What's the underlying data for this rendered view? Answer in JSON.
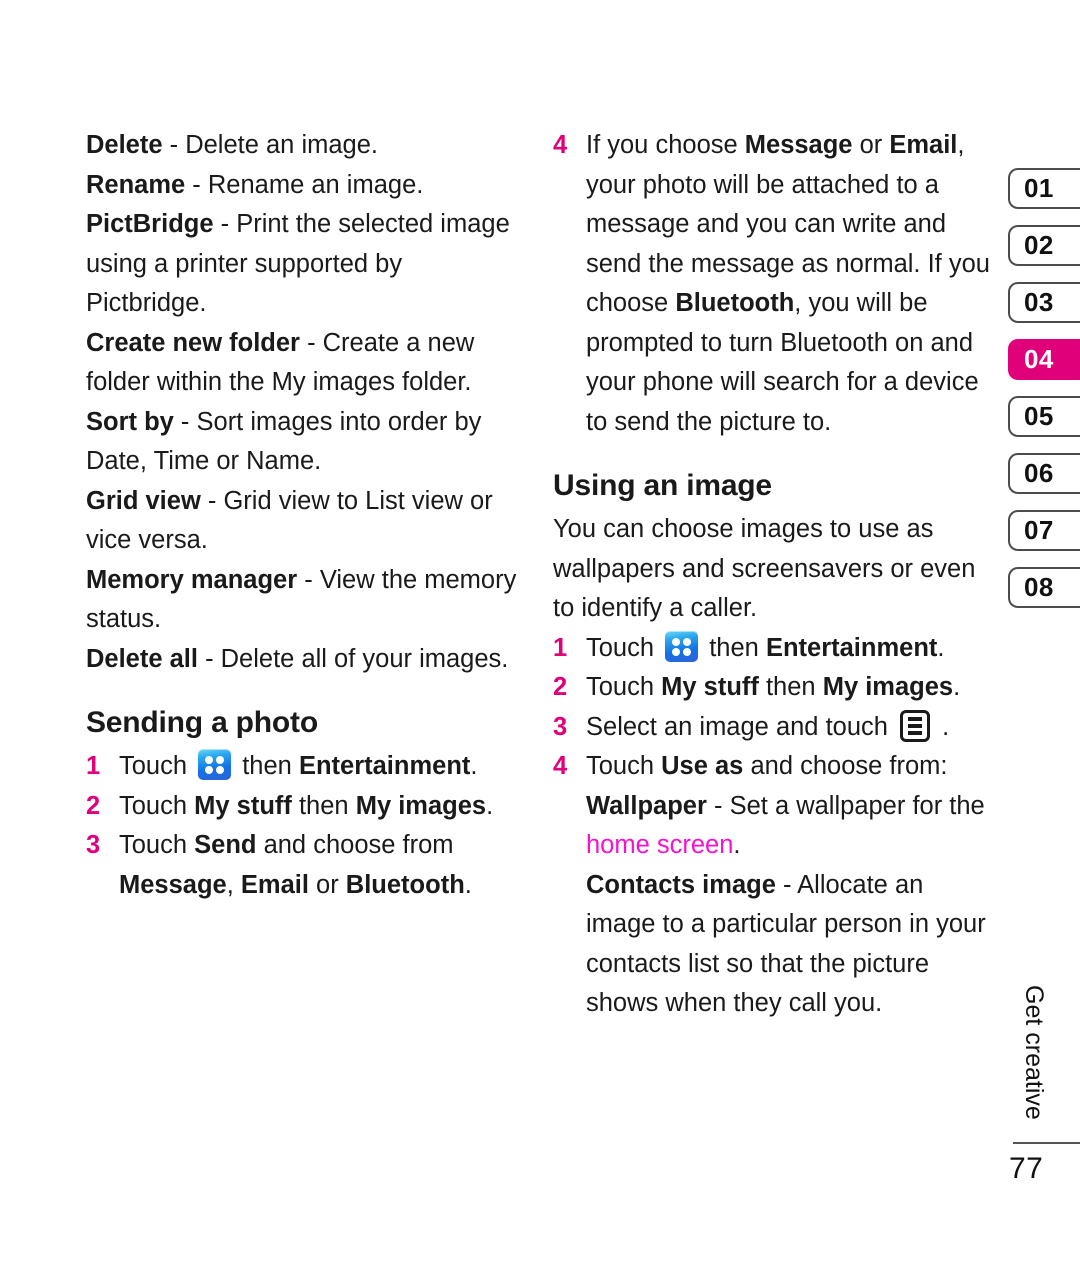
{
  "page": {
    "folio": "77",
    "chapter_label": "Get creative",
    "accent_color": "#e0007a",
    "link_color": "#f712d0"
  },
  "tabs": {
    "items": [
      {
        "label": "01",
        "active": false
      },
      {
        "label": "02",
        "active": false
      },
      {
        "label": "03",
        "active": false
      },
      {
        "label": "04",
        "active": true
      },
      {
        "label": "05",
        "active": false
      },
      {
        "label": "06",
        "active": false
      },
      {
        "label": "07",
        "active": false
      },
      {
        "label": "08",
        "active": false
      }
    ]
  },
  "left_column": {
    "definitions": [
      {
        "term": "Delete",
        "dash": " - ",
        "desc": "Delete an image."
      },
      {
        "term": "Rename",
        "dash": " - ",
        "desc": "Rename an image."
      },
      {
        "term": "PictBridge",
        "dash": " - ",
        "desc": "Print the selected image using a printer supported by Pictbridge."
      },
      {
        "term": "Create new folder",
        "dash": " - ",
        "desc": "Create a new folder within the My images folder."
      },
      {
        "term": "Sort by",
        "dash": " - ",
        "desc": "Sort images into order by Date, Time or Name."
      },
      {
        "term": "Grid view",
        "dash": " - ",
        "desc": "Grid view to List view or vice versa."
      },
      {
        "term": "Memory manager",
        "dash": " - ",
        "desc": "View the memory status."
      },
      {
        "term": "Delete all",
        "dash": " - ",
        "desc": "Delete all of your images."
      }
    ],
    "section": {
      "heading": "Sending a photo",
      "steps": [
        {
          "num": "1",
          "parts": [
            {
              "t": "Touch ",
              "style": "normal"
            },
            {
              "t": "grid-icon",
              "style": "icon-grid"
            },
            {
              "t": " then ",
              "style": "normal"
            },
            {
              "t": "Entertainment",
              "style": "bold"
            },
            {
              "t": ".",
              "style": "normal"
            }
          ]
        },
        {
          "num": "2",
          "parts": [
            {
              "t": "Touch ",
              "style": "normal"
            },
            {
              "t": "My stuff",
              "style": "bold"
            },
            {
              "t": " then ",
              "style": "normal"
            },
            {
              "t": "My images",
              "style": "bold"
            },
            {
              "t": ".",
              "style": "normal"
            }
          ]
        },
        {
          "num": "3",
          "parts": [
            {
              "t": "Touch ",
              "style": "normal"
            },
            {
              "t": "Send",
              "style": "bold"
            },
            {
              "t": " and choose from ",
              "style": "normal"
            },
            {
              "t": "Message",
              "style": "bold"
            },
            {
              "t": ", ",
              "style": "normal"
            },
            {
              "t": "Email",
              "style": "bold"
            },
            {
              "t": " or ",
              "style": "normal"
            },
            {
              "t": "Bluetooth",
              "style": "bold"
            },
            {
              "t": ".",
              "style": "normal"
            }
          ]
        }
      ]
    }
  },
  "right_column": {
    "continued_step": {
      "num": "4",
      "parts": [
        {
          "t": "If you choose ",
          "style": "normal"
        },
        {
          "t": "Message",
          "style": "bold"
        },
        {
          "t": " or ",
          "style": "normal"
        },
        {
          "t": "Email",
          "style": "bold"
        },
        {
          "t": ", your photo will be attached to a message and you can write and send the message as normal. If you choose ",
          "style": "normal"
        },
        {
          "t": "Bluetooth",
          "style": "bold"
        },
        {
          "t": ", you will be prompted to turn Bluetooth on and your phone will search for a device to send the picture to.",
          "style": "normal"
        }
      ]
    },
    "section": {
      "heading": "Using an image",
      "intro": "You can choose images to use as wallpapers and screensavers or even to identify a caller.",
      "steps": [
        {
          "num": "1",
          "parts": [
            {
              "t": "Touch ",
              "style": "normal"
            },
            {
              "t": "grid-icon",
              "style": "icon-grid"
            },
            {
              "t": " then ",
              "style": "normal"
            },
            {
              "t": "Entertainment",
              "style": "bold"
            },
            {
              "t": ".",
              "style": "normal"
            }
          ]
        },
        {
          "num": "2",
          "parts": [
            {
              "t": "Touch ",
              "style": "normal"
            },
            {
              "t": "My stuff",
              "style": "bold"
            },
            {
              "t": " then ",
              "style": "normal"
            },
            {
              "t": "My images",
              "style": "bold"
            },
            {
              "t": ".",
              "style": "normal"
            }
          ]
        },
        {
          "num": "3",
          "parts": [
            {
              "t": "Select an image and touch ",
              "style": "normal"
            },
            {
              "t": "menu-icon",
              "style": "icon-menu"
            },
            {
              "t": " .",
              "style": "normal"
            }
          ]
        },
        {
          "num": "4",
          "parts": [
            {
              "t": "Touch ",
              "style": "normal"
            },
            {
              "t": "Use as",
              "style": "bold"
            },
            {
              "t": " and choose from:",
              "style": "normal"
            }
          ]
        }
      ],
      "options": [
        {
          "parts": [
            {
              "t": "Wallpaper",
              "style": "bold"
            },
            {
              "t": " - Set a wallpaper for the ",
              "style": "normal"
            },
            {
              "t": "home screen",
              "style": "pink"
            },
            {
              "t": ".",
              "style": "normal"
            }
          ]
        },
        {
          "parts": [
            {
              "t": "Contacts image",
              "style": "bold"
            },
            {
              "t": " - Allocate an image to a particular person in your contacts list so that the picture shows when they call you.",
              "style": "normal"
            }
          ]
        }
      ]
    }
  }
}
